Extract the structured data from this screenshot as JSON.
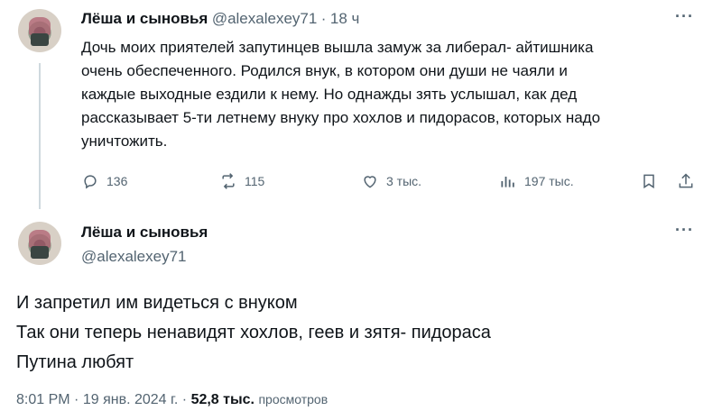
{
  "first_tweet": {
    "author_name": "Лёша и сыновья",
    "handle": "@alexalexey71",
    "separator": "·",
    "time": "18 ч",
    "text_lines": [
      "Дочь моих приятелей запутинцев вышла замуж за либерал- айтишника",
      "очень обеспеченного. Родился внук, в котором они души не чаяли и",
      "каждые выходные ездили к нему. Но однажды зять услышал, как дед",
      "рассказывает 5-ти летнему внуку про хохлов и пидорасов, которых надо",
      "уничтожить."
    ],
    "actions": {
      "replies": "136",
      "reposts": "115",
      "likes": "3 тыс.",
      "views": "197 тыс."
    },
    "more_label": "···"
  },
  "main_tweet": {
    "author_name": "Лёша и сыновья",
    "handle": "@alexalexey71",
    "more_label": "···",
    "text_lines": [
      "И запретил им видеться с внуком",
      "Так они теперь ненавидят хохлов, геев и зятя- пидораса",
      "Путина любят"
    ],
    "time": "8:01 PM",
    "dot": "·",
    "date": "19 янв. 2024 г.",
    "views_count": "52,8 тыс.",
    "views_label": "просмотров"
  },
  "icons": [
    "reply-icon",
    "repost-icon",
    "like-icon",
    "views-icon",
    "bookmark-icon",
    "share-icon"
  ],
  "colors": {
    "text": "#0f1419",
    "secondary": "#536471",
    "line": "#cfd9de"
  }
}
